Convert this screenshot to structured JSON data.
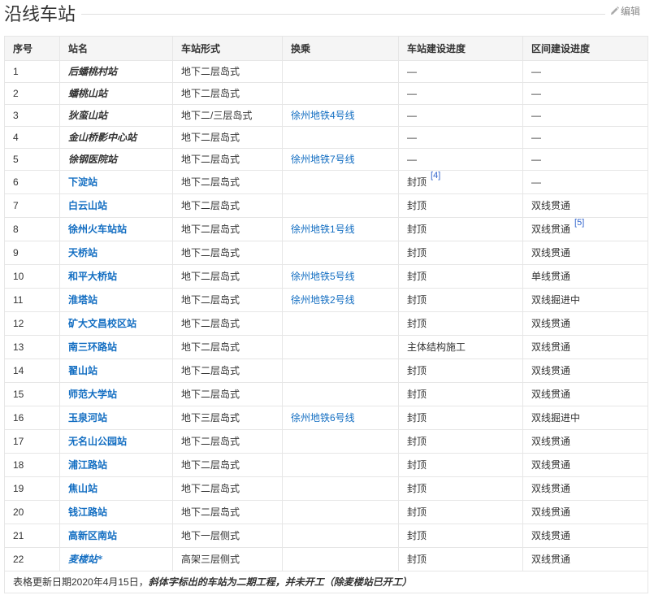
{
  "section": {
    "title": "沿线车站",
    "edit_label": "编辑",
    "edit_icon": "pencil-icon"
  },
  "colors": {
    "text": "#333333",
    "link": "#136ec2",
    "reference": "#3366cc",
    "border": "#e6e6e6",
    "header_background": "#f5f5f5",
    "muted": "#888888"
  },
  "table": {
    "headers": [
      "序号",
      "站名",
      "车站形式",
      "换乘",
      "车站建设进度",
      "区间建设进度"
    ],
    "rows": [
      {
        "no": "1",
        "name": "后蟠桃村站",
        "italic": true,
        "form": "地下二层岛式",
        "station_progress": "—",
        "section_progress": "—"
      },
      {
        "no": "2",
        "name": "蟠桃山站",
        "italic": true,
        "form": "地下二层岛式",
        "station_progress": "—",
        "section_progress": "—"
      },
      {
        "no": "3",
        "name": "狄蛮山站",
        "italic": true,
        "form": "地下二/三层岛式",
        "transfer": "徐州地铁4号线",
        "station_progress": "—",
        "section_progress": "—"
      },
      {
        "no": "4",
        "name": "金山桥影中心站",
        "italic": true,
        "form": "地下二层岛式",
        "station_progress": "—",
        "section_progress": "—"
      },
      {
        "no": "5",
        "name": "徐钢医院站",
        "italic": true,
        "form": "地下二层岛式",
        "transfer": "徐州地铁7号线",
        "station_progress": "—",
        "section_progress": "—"
      },
      {
        "no": "6",
        "name": "下淀站",
        "form": "地下二层岛式",
        "station_progress": "封顶",
        "station_ref": "[4]",
        "section_progress": "—"
      },
      {
        "no": "7",
        "name": "白云山站",
        "form": "地下二层岛式",
        "station_progress": "封顶",
        "section_progress": "双线贯通"
      },
      {
        "no": "8",
        "name": "徐州火车站站",
        "form": "地下二层岛式",
        "transfer": "徐州地铁1号线",
        "station_progress": "封顶",
        "section_progress": "双线贯通",
        "section_ref": "[5]"
      },
      {
        "no": "9",
        "name": "天桥站",
        "form": "地下二层岛式",
        "station_progress": "封顶",
        "section_progress": "双线贯通"
      },
      {
        "no": "10",
        "name": "和平大桥站",
        "form": "地下二层岛式",
        "transfer": "徐州地铁5号线",
        "station_progress": "封顶",
        "section_progress": "单线贯通"
      },
      {
        "no": "11",
        "name": "淮塔站",
        "form": "地下二层岛式",
        "transfer": "徐州地铁2号线",
        "station_progress": "封顶",
        "section_progress": "双线掘进中"
      },
      {
        "no": "12",
        "name": "矿大文昌校区站",
        "form": "地下二层岛式",
        "station_progress": "封顶",
        "section_progress": "双线贯通"
      },
      {
        "no": "13",
        "name": "南三环路站",
        "form": "地下二层岛式",
        "station_progress": "主体结构施工",
        "section_progress": "双线贯通"
      },
      {
        "no": "14",
        "name": "翟山站",
        "form": "地下二层岛式",
        "station_progress": "封顶",
        "section_progress": "双线贯通"
      },
      {
        "no": "15",
        "name": "师范大学站",
        "form": "地下二层岛式",
        "station_progress": "封顶",
        "section_progress": "双线贯通"
      },
      {
        "no": "16",
        "name": "玉泉河站",
        "form": "地下三层岛式",
        "transfer": "徐州地铁6号线",
        "station_progress": "封顶",
        "section_progress": "双线掘进中"
      },
      {
        "no": "17",
        "name": "无名山公园站",
        "form": "地下二层岛式",
        "station_progress": "封顶",
        "section_progress": "双线贯通"
      },
      {
        "no": "18",
        "name": "浦江路站",
        "form": "地下二层岛式",
        "station_progress": "封顶",
        "section_progress": "双线贯通"
      },
      {
        "no": "19",
        "name": "焦山站",
        "form": "地下二层岛式",
        "station_progress": "封顶",
        "section_progress": "双线贯通"
      },
      {
        "no": "20",
        "name": "钱江路站",
        "form": "地下二层岛式",
        "station_progress": "封顶",
        "section_progress": "双线贯通"
      },
      {
        "no": "21",
        "name": "高新区南站",
        "form": "地下一层侧式",
        "station_progress": "封顶",
        "section_progress": "双线贯通"
      },
      {
        "no": "22",
        "name": "麦楼站*",
        "italic": true,
        "form": "高架三层侧式",
        "station_progress": "封顶",
        "section_progress": "双线贯通"
      }
    ],
    "footer": {
      "prefix": "表格更新日期2020年4月15日，",
      "note": "斜体字标出的车站为二期工程，并未开工（除麦楼站已开工）"
    }
  }
}
